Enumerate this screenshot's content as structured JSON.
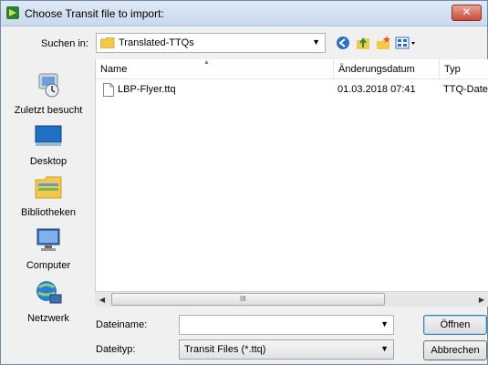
{
  "window": {
    "title": "Choose Transit file to import:",
    "close_label": "✕"
  },
  "lookin": {
    "label": "Suchen in:",
    "folder": "Translated-TTQs"
  },
  "toolbar": {
    "icons": [
      "back-icon",
      "up-folder-icon",
      "new-folder-icon",
      "view-menu-icon"
    ]
  },
  "places": [
    {
      "label": "Zuletzt besucht",
      "icon": "recent-places-icon"
    },
    {
      "label": "Desktop",
      "icon": "desktop-icon"
    },
    {
      "label": "Bibliotheken",
      "icon": "libraries-icon"
    },
    {
      "label": "Computer",
      "icon": "computer-icon"
    },
    {
      "label": "Netzwerk",
      "icon": "network-icon"
    }
  ],
  "filelist": {
    "columns": [
      "Name",
      "Änderungsdatum",
      "Typ"
    ],
    "rows": [
      {
        "name": "LBP-Flyer.ttq",
        "modified": "01.03.2018 07:41",
        "type": "TTQ-Date"
      }
    ],
    "scroll_grip": "III"
  },
  "fields": {
    "filename_label": "Dateiname:",
    "filename_value": "",
    "filetype_label": "Dateityp:",
    "filetype_value": "Transit Files (*.ttq)"
  },
  "buttons": {
    "open": "Öffnen",
    "cancel": "Abbrechen"
  }
}
